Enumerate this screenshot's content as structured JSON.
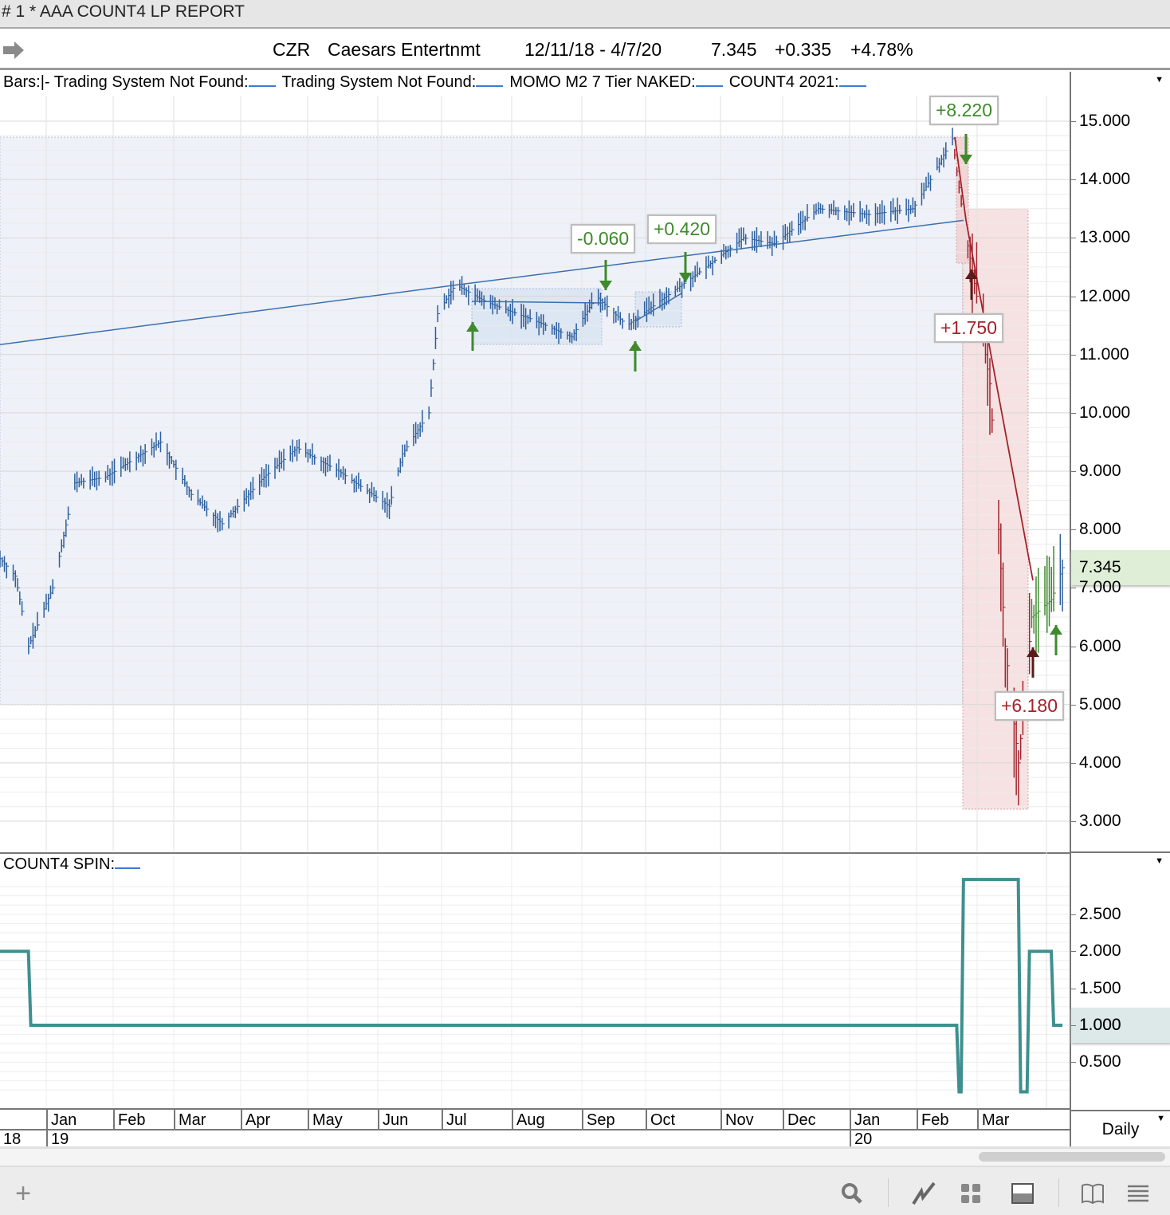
{
  "window": {
    "title": "# 1 * AAA COUNT4 LP REPORT"
  },
  "header": {
    "symbol": "CZR",
    "name": "Caesars Entertnmt",
    "range": "12/11/18 - 4/7/20",
    "last": "7.345",
    "change": "+0.335",
    "pct": "+4.78%"
  },
  "legend": {
    "bars": "Bars:",
    "studies": [
      "|- Trading System Not Found:",
      "Trading System Not Found:",
      "MOMO M2 7 Tier NAKED:",
      "COUNT4 2021:"
    ]
  },
  "lower_legend": "COUNT4 SPIN:",
  "period": "Daily",
  "colors": {
    "bar": "#2c5f9e",
    "short": "#a3232c",
    "long": "#3e8a2c",
    "spin": "#3f8f8f",
    "ma": "#3a6fb0"
  },
  "chart_data": [
    {
      "type": "line",
      "title": "CZR daily bars",
      "ylim": [
        3,
        15
      ],
      "yticks": [
        "15.000",
        "14.000",
        "13.000",
        "12.000",
        "11.000",
        "10.000",
        "9.000",
        "8.000",
        "7.000",
        "6.000",
        "5.000",
        "4.000",
        "3.000"
      ],
      "last_value_label": "7.345",
      "price_path": [
        [
          "2018-12-11",
          7.5
        ],
        [
          "2018-12-18",
          7.2
        ],
        [
          "2018-12-24",
          6.0
        ],
        [
          "2019-01-04",
          7.0
        ],
        [
          "2019-01-14",
          8.8
        ],
        [
          "2019-01-28",
          8.9
        ],
        [
          "2019-02-22",
          9.5
        ],
        [
          "2019-03-08",
          8.6
        ],
        [
          "2019-03-22",
          8.1
        ],
        [
          "2019-04-10",
          8.9
        ],
        [
          "2019-04-25",
          9.4
        ],
        [
          "2019-05-14",
          9.0
        ],
        [
          "2019-06-06",
          8.4
        ],
        [
          "2019-06-12",
          9.3
        ],
        [
          "2019-06-24",
          10.0
        ],
        [
          "2019-06-28",
          11.7
        ],
        [
          "2019-07-06",
          12.2
        ],
        [
          "2019-07-20",
          11.9
        ],
        [
          "2019-08-10",
          11.6
        ],
        [
          "2019-08-28",
          11.3
        ],
        [
          "2019-09-08",
          12.0
        ],
        [
          "2019-09-22",
          11.5
        ],
        [
          "2019-10-10",
          12.0
        ],
        [
          "2019-10-28",
          12.5
        ],
        [
          "2019-11-14",
          13.0
        ],
        [
          "2019-11-28",
          12.9
        ],
        [
          "2019-12-18",
          13.5
        ],
        [
          "2020-01-10",
          13.4
        ],
        [
          "2020-01-30",
          13.5
        ],
        [
          "2020-02-07",
          14.0
        ],
        [
          "2020-02-17",
          14.7
        ],
        [
          "2020-02-22",
          13.3
        ],
        [
          "2020-02-28",
          12.0
        ],
        [
          "2020-03-05",
          10.5
        ],
        [
          "2020-03-09",
          8.0
        ],
        [
          "2020-03-12",
          6.0
        ],
        [
          "2020-03-18",
          4.0
        ],
        [
          "2020-03-24",
          6.5
        ],
        [
          "2020-04-02",
          6.8
        ],
        [
          "2020-04-07",
          7.345
        ]
      ],
      "moving_average": [
        [
          "2018-12-11",
          11.17
        ],
        [
          "2019-07-08",
          12.2
        ],
        [
          "2020-02-22",
          13.3
        ]
      ],
      "trades": [
        {
          "label": "+8.220",
          "color": "#3e8a2c",
          "side": "long"
        },
        {
          "label": "-0.060",
          "color": "#3e8a2c",
          "side": "long"
        },
        {
          "label": "+0.420",
          "color": "#3e8a2c",
          "side": "long"
        },
        {
          "label": "+1.750",
          "color": "#a3232c",
          "side": "short"
        },
        {
          "label": "+6.180",
          "color": "#a3232c",
          "side": "short"
        }
      ]
    },
    {
      "type": "line",
      "title": "COUNT4 SPIN",
      "ylim": [
        0,
        3
      ],
      "yticks": [
        "2.500",
        "2.000",
        "1.500",
        "1.000",
        "0.500"
      ],
      "last_value_label": "1.000",
      "steps": [
        [
          "2018-12-11",
          2.0
        ],
        [
          "2018-12-25",
          1.0
        ],
        [
          "2020-02-20",
          0.1
        ],
        [
          "2020-02-22",
          2.97
        ],
        [
          "2020-03-19",
          0.1
        ],
        [
          "2020-03-23",
          2.0
        ],
        [
          "2020-04-03",
          1.0
        ],
        [
          "2020-04-07",
          1.0
        ]
      ]
    }
  ],
  "timeaxis": {
    "months": [
      "Jan",
      "Feb",
      "Mar",
      "Apr",
      "May",
      "Jun",
      "Jul",
      "Aug",
      "Sep",
      "Oct",
      "Nov",
      "Dec",
      "Jan",
      "Feb",
      "Mar"
    ],
    "years": [
      "18",
      "19",
      "20"
    ]
  }
}
